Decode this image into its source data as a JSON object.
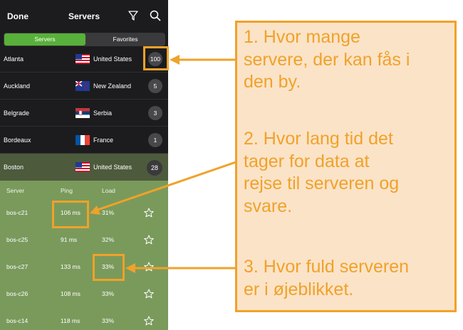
{
  "header": {
    "done_label": "Done",
    "title": "Servers",
    "filter_icon": "filter-icon",
    "search_icon": "search-icon"
  },
  "tabs": {
    "servers": "Servers",
    "favorites": "Favorites",
    "active": "servers"
  },
  "locations": [
    {
      "city": "Atlanta",
      "country": "United States",
      "flag": "us-flag",
      "count": "100"
    },
    {
      "city": "Auckland",
      "country": "New Zealand",
      "flag": "nz-flag",
      "count": "5"
    },
    {
      "city": "Belgrade",
      "country": "Serbia",
      "flag": "rs-flag",
      "count": "3"
    },
    {
      "city": "Bordeaux",
      "country": "France",
      "flag": "fr-flag",
      "count": "1"
    },
    {
      "city": "Boston",
      "country": "United States",
      "flag": "us-flag",
      "count": "28",
      "expanded": true
    }
  ],
  "server_table": {
    "headers": {
      "server": "Server",
      "ping": "Ping",
      "load": "Load"
    },
    "rows": [
      {
        "server": "bos-c21",
        "ping": "106 ms",
        "load": "31%"
      },
      {
        "server": "bos-c25",
        "ping": "91 ms",
        "load": "32%"
      },
      {
        "server": "bos-c27",
        "ping": "133 ms",
        "load": "33%"
      },
      {
        "server": "bos-c26",
        "ping": "108 ms",
        "load": "33%"
      },
      {
        "server": "bos-c14",
        "ping": "118 ms",
        "load": "33%"
      }
    ]
  },
  "annotations": {
    "note1": [
      "1. Hvor mange",
      "servere, der kan fås i",
      "den by."
    ],
    "note2": [
      "2. Hvor lang tid det",
      "tager for data at",
      "rejse til serveren og",
      "svare."
    ],
    "note3": [
      "3. Hvor fuld serveren",
      "er i øjeblikket."
    ]
  },
  "colors": {
    "accent": "#f0a229",
    "panel": "#fbe3c8",
    "tab_active": "#58b13a",
    "server_panel": "#7a9a5c",
    "boston_row": "#4d5a3c",
    "dark_bg": "#1c1c1e"
  }
}
